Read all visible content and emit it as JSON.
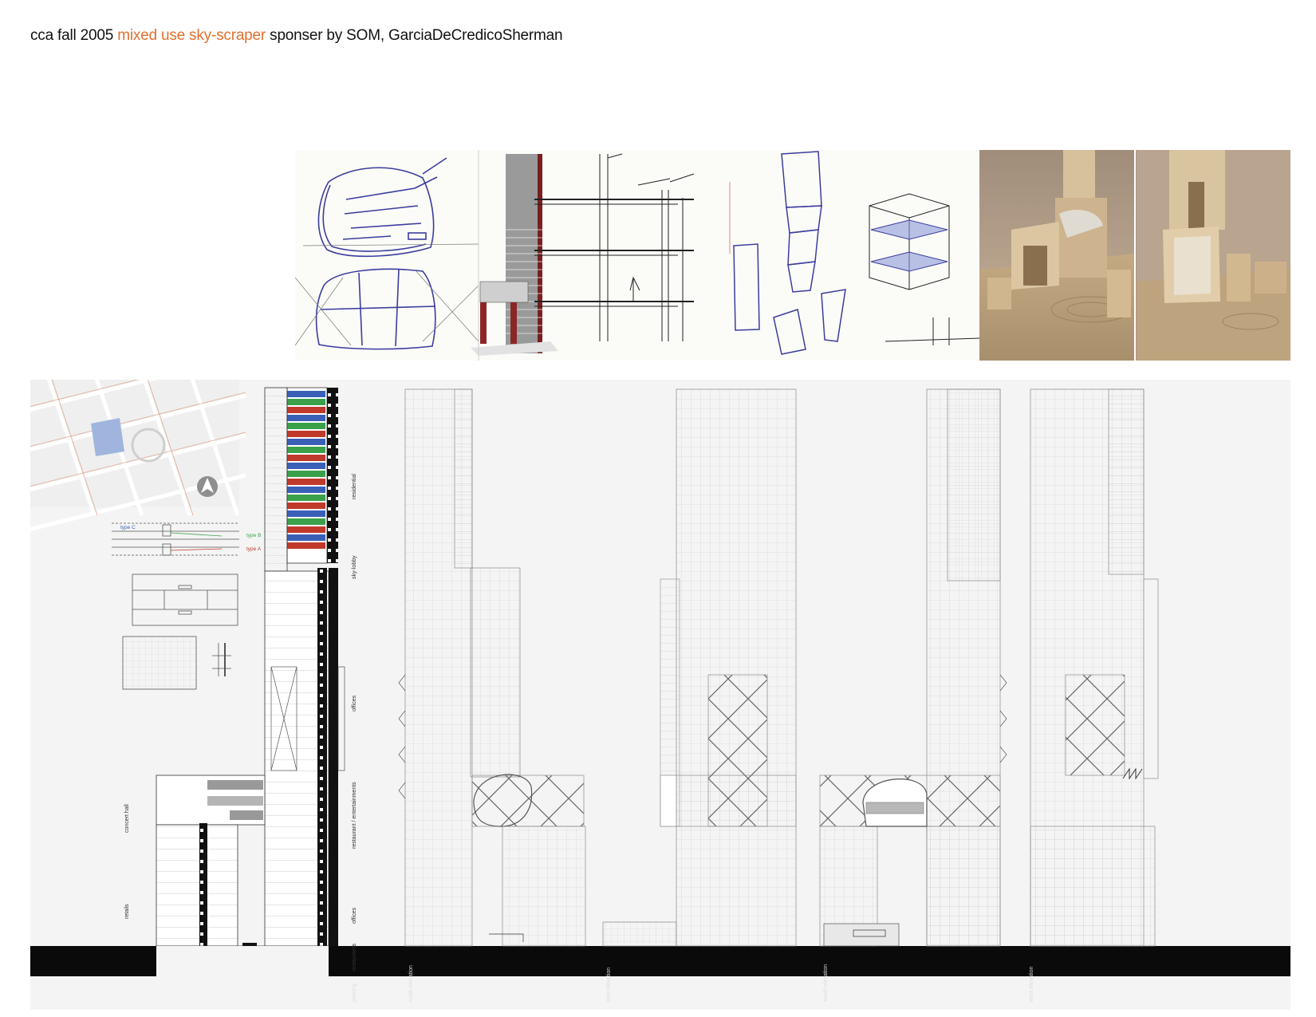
{
  "title": {
    "part1": "cca fall 2005",
    "accent": "mixed use sky-scraper",
    "part2": "sponser by SOM, GarciaDeCredicoSherman"
  },
  "colors": {
    "accent": "#e0702e",
    "type_a": "#c0392b",
    "type_b": "#3aa14a",
    "type_c": "#3a5fb6",
    "sketch_ink": "#3b3d9e",
    "model_wood": "#c8a878"
  },
  "program_labels": {
    "residential": "residential",
    "sky_lobby": "sky-lobby",
    "offices_upper": "offices",
    "restaurant": "restaurant / entertainments",
    "offices_lower": "offices",
    "restaurants": "restaurants",
    "parking": "parking",
    "concert_hall": "concert hall",
    "retails": "retails"
  },
  "unit_types": {
    "type_a": "type A",
    "type_b": "type B",
    "type_c": "type C"
  },
  "elevations": {
    "north": "north elevation",
    "east": "east elevation",
    "south": "south elevation",
    "west": "west elevation"
  },
  "icons": {
    "north_arrow": "north-arrow-icon"
  }
}
